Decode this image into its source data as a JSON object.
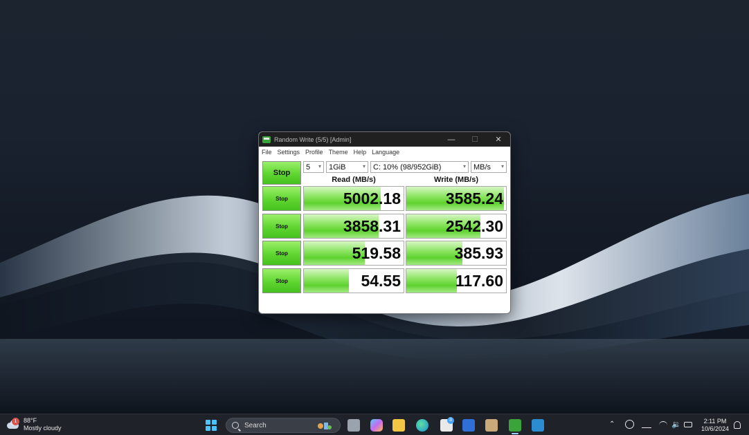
{
  "window": {
    "title": "Random Write (5/5) [Admin]",
    "menu": [
      "File",
      "Settings",
      "Profile",
      "Theme",
      "Help",
      "Language"
    ],
    "controls": {
      "minimize": "—",
      "maximize": "☐",
      "close": "✕"
    }
  },
  "benchmark": {
    "stop_all_label": "Stop",
    "count_value": "5",
    "size_value": "1GiB",
    "drive_value": "C: 10% (98/952GiB)",
    "unit_value": "MB/s",
    "read_header": "Read (MB/s)",
    "write_header": "Write (MB/s)",
    "rows": [
      {
        "stop_label": "Stop",
        "read": "5002.18",
        "write": "3585.24",
        "read_fill": 0.77,
        "write_fill": 0.98
      },
      {
        "stop_label": "Stop",
        "read": "3858.31",
        "write": "2542.30",
        "read_fill": 0.75,
        "write_fill": 0.74
      },
      {
        "stop_label": "Stop",
        "read": "519.58",
        "write": "385.93",
        "read_fill": 0.61,
        "write_fill": 0.56
      },
      {
        "stop_label": "Stop",
        "read": "54.55",
        "write": "117.60",
        "read_fill": 0.45,
        "write_fill": 0.51
      }
    ],
    "comment": ""
  },
  "taskbar": {
    "weather_temp": "88°F",
    "weather_desc": "Mostly cloudy",
    "weather_badge": "1",
    "search_placeholder": "Search",
    "store_badge": "3",
    "time": "2:11 PM",
    "date": "10/6/2024"
  },
  "colors": {
    "accent_green": "#5fd630",
    "titlebar": "#202020",
    "taskbar": "#1f2329"
  }
}
